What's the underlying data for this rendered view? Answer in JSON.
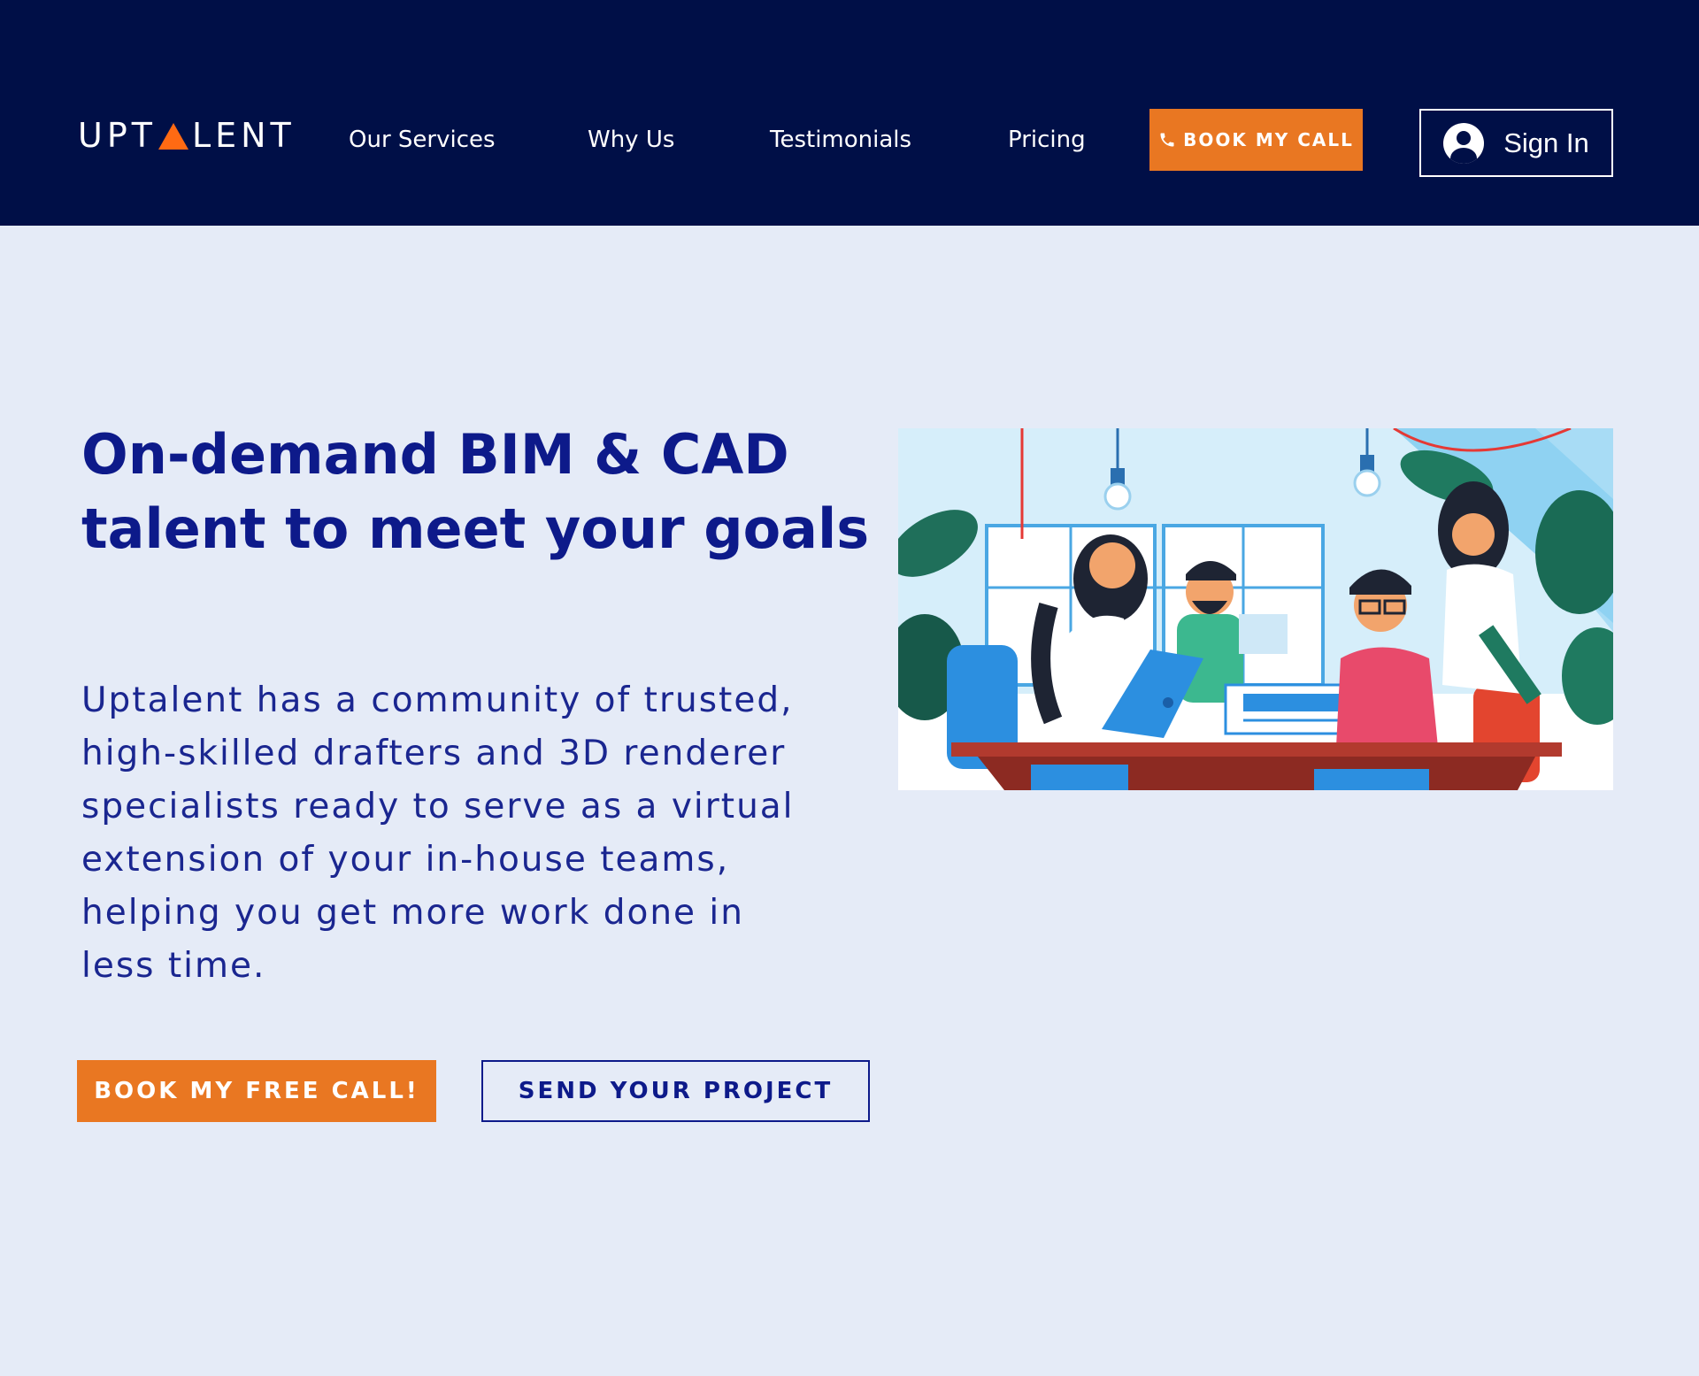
{
  "header": {
    "logo": {
      "text_left": "UPT",
      "text_right": "LENT",
      "icon": "triangle-a-icon",
      "accent_color": "#ff6a13"
    },
    "nav": [
      {
        "label": "Our Services"
      },
      {
        "label": "Why Us"
      },
      {
        "label": "Testimonials"
      },
      {
        "label": "Pricing"
      }
    ],
    "book_call_label": "BOOK MY CALL",
    "book_call_icon": "phone-icon",
    "sign_in_label": "Sign In",
    "sign_in_icon": "user-avatar-icon",
    "background_color": "#000f47"
  },
  "hero": {
    "title": "On-demand BIM & CAD talent to meet your goals",
    "description": "Uptalent has a community of trusted, high-skilled drafters and 3D  renderer specialists ready to serve as a virtual extension of your in-house teams, helping you get more work done in less time.",
    "primary_button": "BOOK MY FREE CALL!",
    "secondary_button": "SEND YOUR PROJECT",
    "illustration": "team-collaboration-illustration"
  },
  "colors": {
    "page_background": "#e5ebf7",
    "accent_orange": "#e97722",
    "heading_blue": "#0d1a8a"
  }
}
